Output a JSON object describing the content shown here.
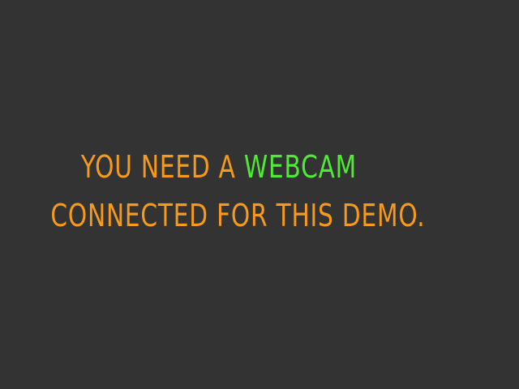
{
  "message": {
    "line1_prefix": "YOU NEED A ",
    "line1_highlight": "WEBCAM",
    "line2": "CONNECTED FOR THIS DEMO."
  },
  "colors": {
    "background": "#333333",
    "text": "#f59a1c",
    "highlight": "#4fea35"
  }
}
